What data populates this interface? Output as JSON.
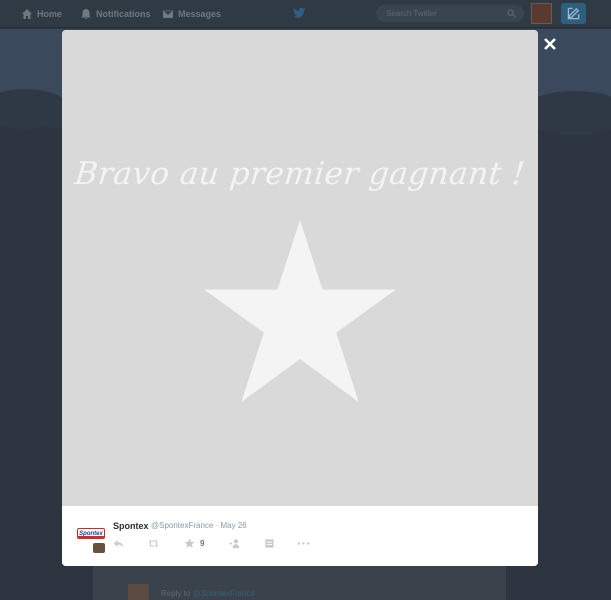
{
  "nav": {
    "home_label": "Home",
    "notifications_label": "Notifications",
    "messages_label": "Messages",
    "search_placeholder": "Search Twitter"
  },
  "media": {
    "caption": "Bravo au premier gagnant !"
  },
  "tweet": {
    "brand_logo_text": "Spontex",
    "name": "Spontex",
    "meta": "@SpontexFrance · May 26",
    "favorite_count": "9"
  },
  "background": {
    "reply_prefix": "Reply to",
    "reply_handle": "@SpontexFrance"
  },
  "icons": {
    "home": "home-icon",
    "notifications": "bell-icon",
    "messages": "envelope-icon",
    "twitter": "twitter-bird-icon",
    "search": "search-icon",
    "compose": "compose-icon",
    "close": "close-icon",
    "star": "star-icon",
    "reply": "reply-icon",
    "retweet": "retweet-icon",
    "favorite": "favorite-star-icon",
    "follow": "follow-icon",
    "embed": "embed-icon",
    "more": "more-dots-icon"
  },
  "colors": {
    "media_background": "#d9d9d9",
    "overlay": "#2c3540",
    "name_text": "#292f33",
    "meta_text": "#8899a6",
    "action_icon": "#c4ccd3"
  }
}
